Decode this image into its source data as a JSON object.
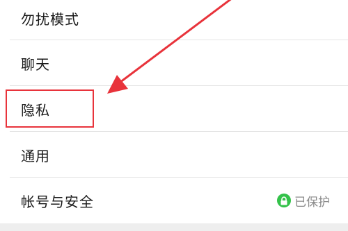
{
  "settings": {
    "items": [
      {
        "label": "勿扰模式"
      },
      {
        "label": "聊天"
      },
      {
        "label": "隐私"
      },
      {
        "label": "通用"
      },
      {
        "label": "帐号与安全",
        "status": "已保护"
      }
    ]
  },
  "colors": {
    "annotation_red": "#e8333b",
    "protected_green": "#34c24a"
  },
  "icons": {
    "status_icon": "lock-icon",
    "annotation": "arrow-annotation"
  }
}
